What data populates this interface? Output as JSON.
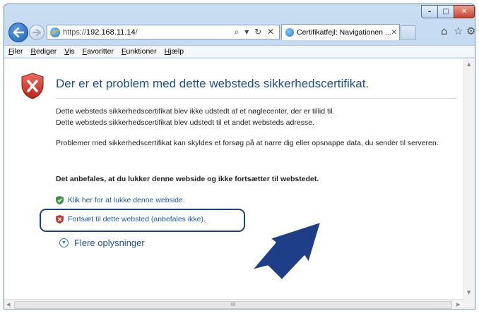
{
  "window": {
    "caption_buttons": {
      "minimize_icon": "minimize-icon",
      "maximize_icon": "maximize-icon",
      "close_icon": "close-icon"
    }
  },
  "navigation": {
    "address_prefix": "https://",
    "address_host": "192.168.11.14",
    "address_suffix": "/",
    "address_tools": "⌕ ▾ ↻ ✕",
    "tab_label": "Certifikatfejl: Navigationen ...",
    "tab_close": "✕"
  },
  "menu": [
    "Filer",
    "Rediger",
    "Vis",
    "Favoritter",
    "Funktioner",
    "Hjælp"
  ],
  "page": {
    "heading": "Der er et problem med dette websteds sikkerhedscertifikat.",
    "para1_line1": "Dette websteds sikkerhedscertifikat blev ikke udstedt af et nøglecenter, der er tillid til.",
    "para1_line2": "Dette websteds sikkerhedscertifikat blev udstedt til et andet websteds adresse.",
    "para2": "Problemer med sikkerhedscertifikat kan skyldes et forsøg på at narre dig eller opsnappe data, du sender til serveren.",
    "recommendation": "Det anbefales, at du lukker denne webside og ikke fortsætter til webstedet.",
    "close_link": "Klik her for at lukke denne webside.",
    "continue_link": "Fortsæt til dette websted (anbefales ikke).",
    "more_info": "Flere oplysninger"
  },
  "scrollbar": {
    "thumb_grip": "III"
  },
  "colors": {
    "callout": "#1e3f87",
    "link": "#1a5aa8",
    "heading": "#1f4f8a"
  }
}
